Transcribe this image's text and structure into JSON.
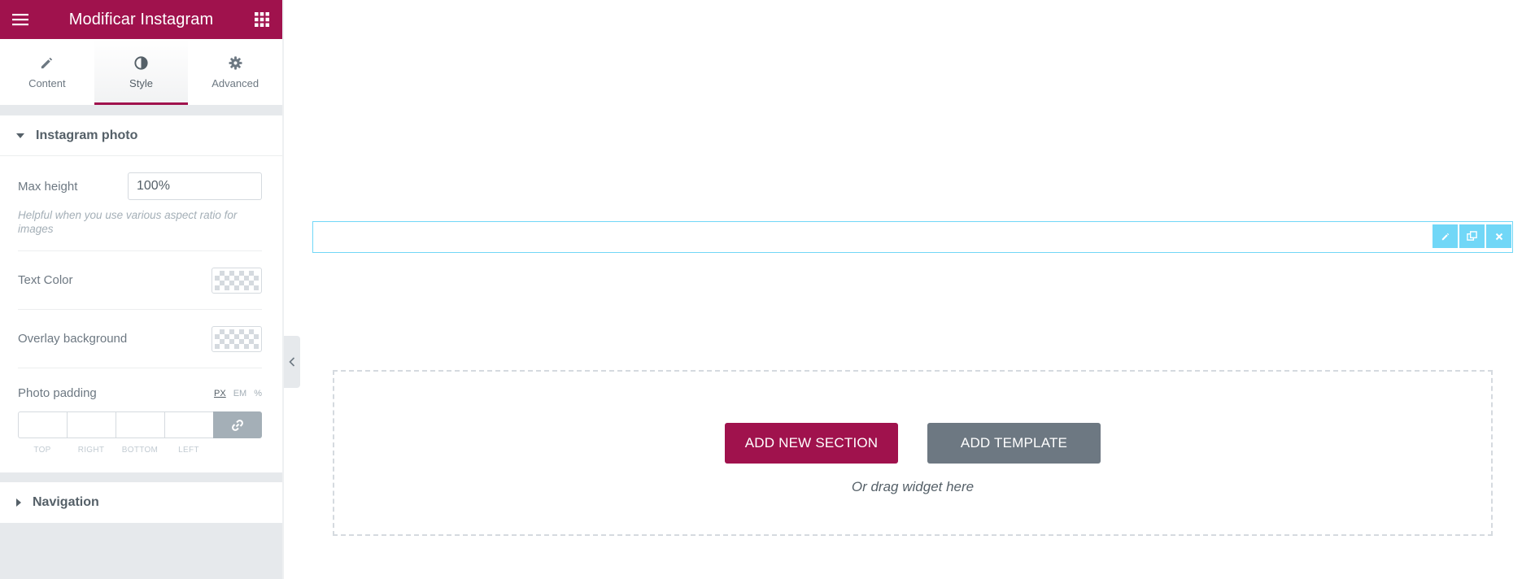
{
  "panel": {
    "header_title": "Modificar Instagram",
    "colors": {
      "brand": "#a0124d",
      "panel_bg": "#e6e9ec",
      "section_tools": "#71d7f7"
    }
  },
  "tabs": [
    {
      "label": "Content",
      "icon": "pencil-icon",
      "active": false
    },
    {
      "label": "Style",
      "icon": "contrast-icon",
      "active": true
    },
    {
      "label": "Advanced",
      "icon": "gear-icon",
      "active": false
    }
  ],
  "instagram_photo": {
    "title": "Instagram photo",
    "max_height_label": "Max height",
    "max_height_value": "100%",
    "max_height_help": "Helpful when you use various aspect ratio for images",
    "text_color_label": "Text Color",
    "overlay_label": "Overlay background",
    "padding_label": "Photo padding",
    "units": [
      "PX",
      "EM",
      "%"
    ],
    "dims": [
      "TOP",
      "RIGHT",
      "BOTTOM",
      "LEFT"
    ]
  },
  "navigation": {
    "title": "Navigation"
  },
  "canvas": {
    "add_section_label": "ADD NEW SECTION",
    "add_template_label": "ADD TEMPLATE",
    "drag_hint": "Or drag widget here"
  }
}
